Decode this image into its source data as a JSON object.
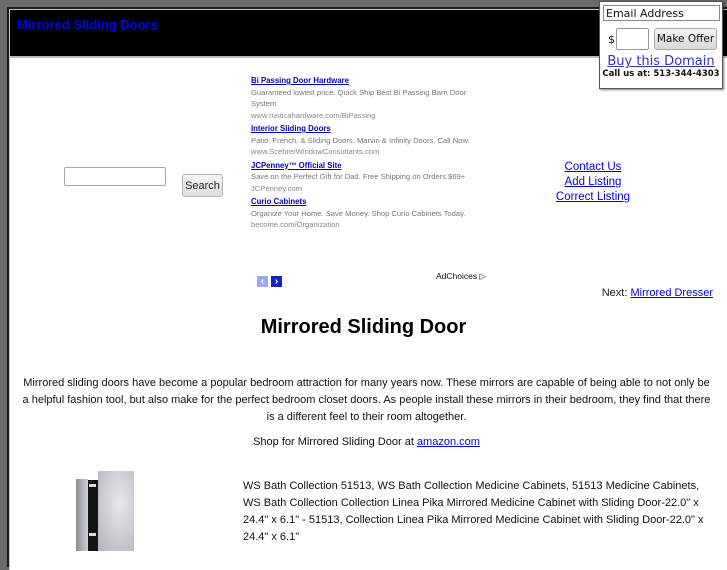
{
  "header": {
    "site_title": "Mirrored Sliding Doors"
  },
  "search": {
    "input_value": "",
    "button_label": "Search"
  },
  "ads": {
    "items": [
      {
        "title": "Bi Passing Door Hardware",
        "description": "Guaranteed lowest price. Quick Ship Best Bi Passing Barn Door System",
        "url": "www.rusticahardware.com/BiPassing"
      },
      {
        "title": "Interior Sliding Doors",
        "description": "Patio. French. & Sliding Doors. Marvin & Infinity Doors. Call Now.",
        "url": "www.ScehrerWindowConsultants.com"
      },
      {
        "title": "JCPenney™ Official Site",
        "description": "Save on the Perfect Gift for Dad. Free Shipping on Orders $69+",
        "url": "JCPenney.com"
      },
      {
        "title": "Curio Cabinets",
        "description": "Organize Your Home. Save Money. Shop Curio Cabinets Today.",
        "url": "become.com/Organization"
      }
    ],
    "prev_icon": "‹",
    "next_icon": "›",
    "adchoices_label": "AdChoices ▷"
  },
  "right_links": {
    "items": [
      "Contact Us",
      "Add Listing",
      "Correct Listing"
    ]
  },
  "next": {
    "prefix": "Next:",
    "link_label": "Mirrored Dresser"
  },
  "main": {
    "title": "Mirrored Sliding Door",
    "intro": "Mirrored sliding doors have become a popular bedroom attraction for many years now. These mirrors are capable of being able to not only be a helpful fashion tool, but also make for the perfect bedroom closet doors. As people install these mirrors in their bedroom, they find that there is a different feel to their room altogether.",
    "shop_prefix": "Shop for Mirrored Sliding Door at",
    "shop_link": "amazon.com",
    "product_description": "WS Bath Collection 51513, WS Bath Collection Medicine Cabinets, 51513 Medicine Cabinets, WS Bath Collection Collection Linea Pika Mirrored Medicine Cabinet with Sliding Door-22.0\" x 24.4\" x 6.1\" - 51513, Collection Linea Pika Mirrored Medicine Cabinet with Sliding Door-22.0\" x 24.4\" x 6.1\""
  },
  "offer_box": {
    "email_value": "Email Address",
    "currency_symbol": "$",
    "amount_value": "",
    "button_label": "Make Offer",
    "buy_link": "Buy this Domain",
    "call_text": "Call us at: 513-344-4303"
  }
}
